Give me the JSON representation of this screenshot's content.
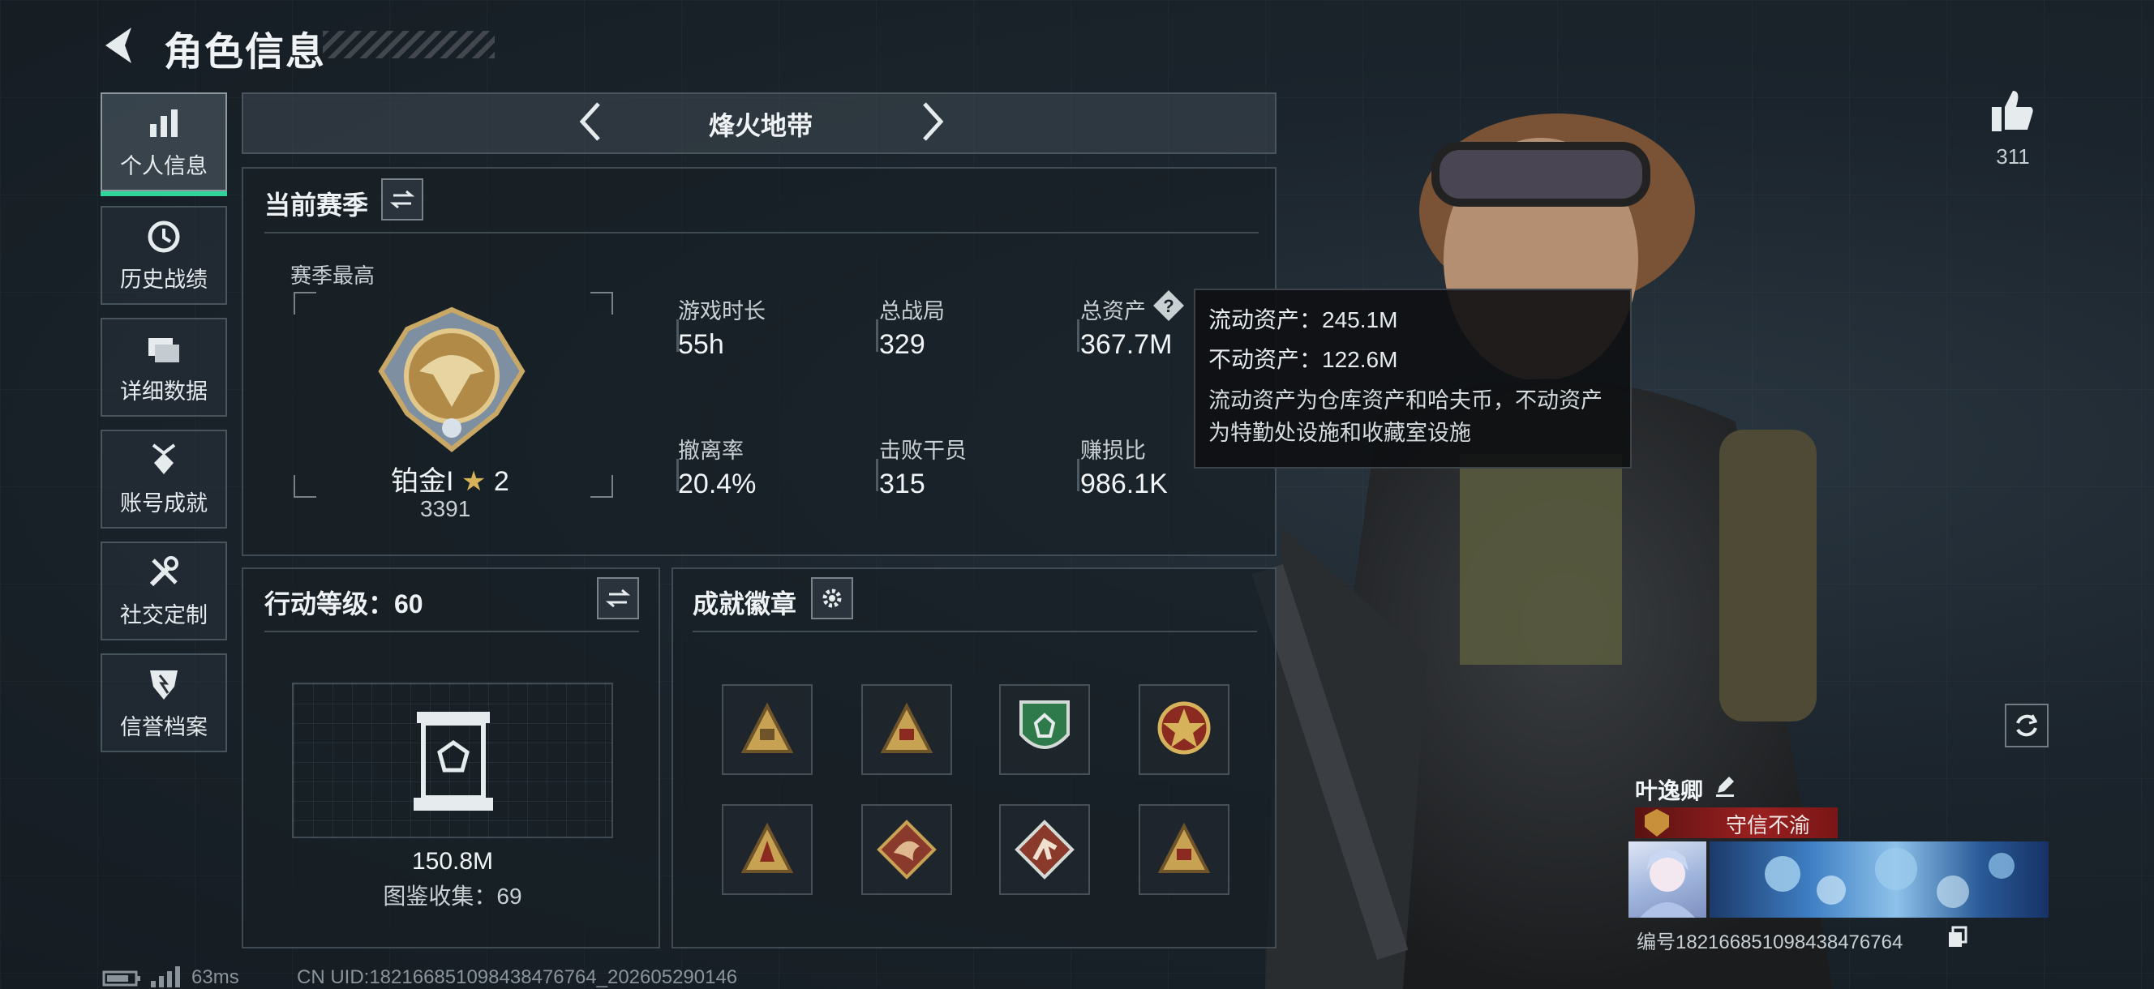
{
  "header": {
    "title": "角色信息"
  },
  "nav": {
    "items": [
      {
        "label": "个人信息",
        "icon": "bar-chart-icon"
      },
      {
        "label": "历史战绩",
        "icon": "clock-icon"
      },
      {
        "label": "详细数据",
        "icon": "folder-icon"
      },
      {
        "label": "账号成就",
        "icon": "medal-icon"
      },
      {
        "label": "社交定制",
        "icon": "tools-icon"
      },
      {
        "label": "信誉档案",
        "icon": "shield-icon"
      }
    ]
  },
  "mode": {
    "name": "烽火地带"
  },
  "season": {
    "title": "当前赛季",
    "best_label": "赛季最高",
    "rank_name": "铂金I",
    "rank_stars": "2",
    "rank_points": "3391",
    "stats": [
      {
        "label": "游戏时长",
        "value": "55h"
      },
      {
        "label": "总战局",
        "value": "329"
      },
      {
        "label": "总资产",
        "value": "367.7M"
      },
      {
        "label": "撤离率",
        "value": "20.4%"
      },
      {
        "label": "击败干员",
        "value": "315"
      },
      {
        "label": "赚损比",
        "value": "986.1K"
      }
    ]
  },
  "tooltip": {
    "liquid": "流动资产：245.1M",
    "fixed": "不动资产：122.6M",
    "desc_line1": "流动资产为仓库资产和哈夫币，不动资产",
    "desc_line2": "为特勤处设施和收藏室设施"
  },
  "action_level": {
    "title": "行动等级：60",
    "value": "150.8M",
    "collection": "图鉴收集：69"
  },
  "achievements": {
    "title": "成就徽章",
    "badges": [
      "badge-triangle-24",
      "badge-triangle-58",
      "badge-green-shield",
      "badge-star-emblem",
      "badge-triangle-gold",
      "badge-dragon",
      "badge-runner",
      "badge-triangle-59"
    ]
  },
  "likes": {
    "count": "311"
  },
  "player": {
    "name": "叶逸卿",
    "title_tag": "守信不渝",
    "id_line": "编号1821668510984384767​64"
  },
  "footer": {
    "ping": "63ms",
    "uid": "CN UID:1821668510984384767​64_202605290146"
  },
  "colors": {
    "accent": "#2fd49a",
    "tag_red": "#8e1b1b"
  }
}
